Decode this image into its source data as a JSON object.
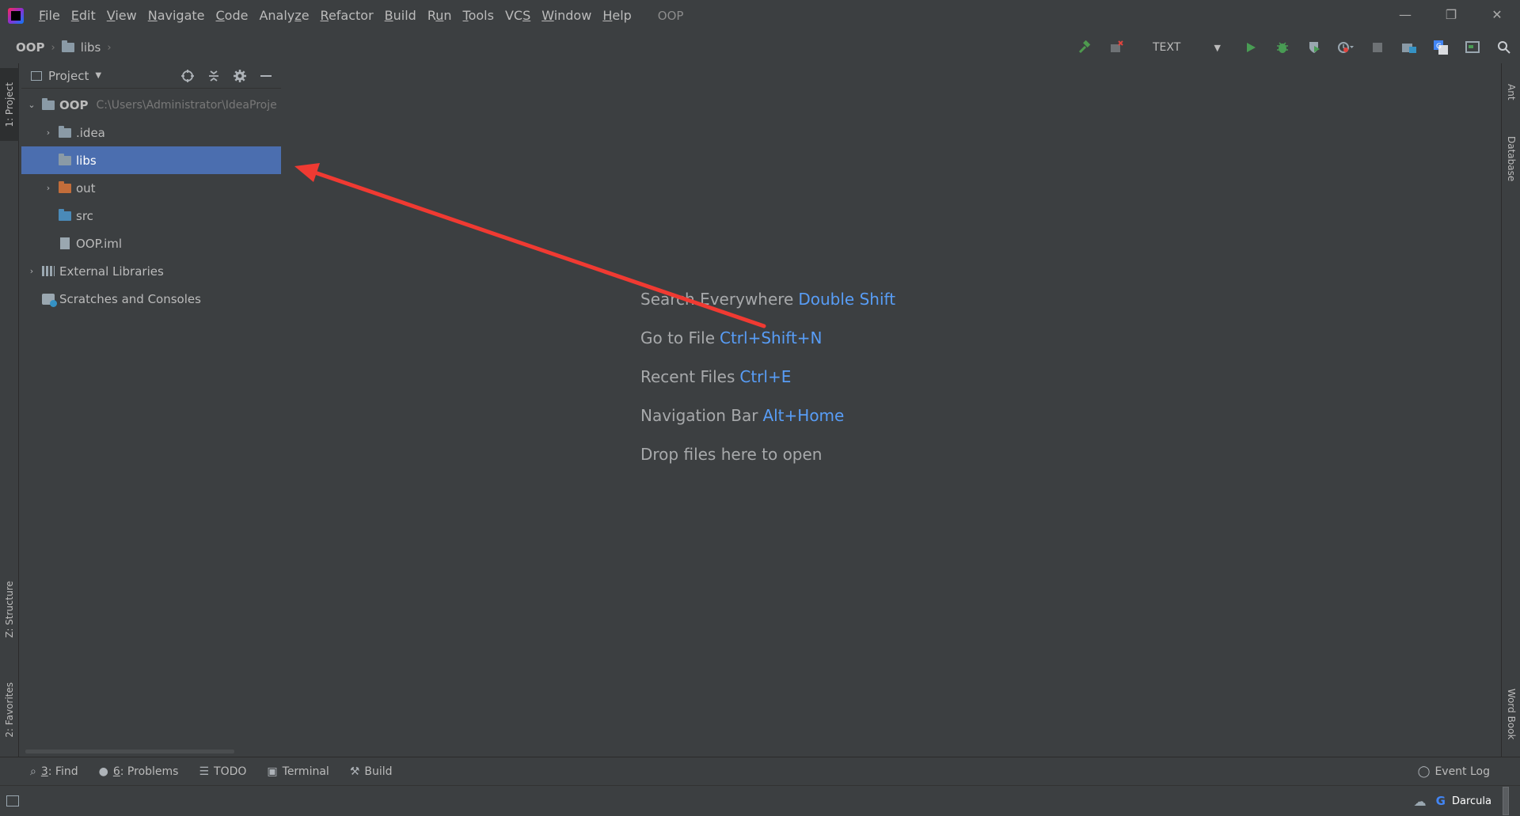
{
  "menubar": {
    "items": [
      {
        "pre": "",
        "ul": "F",
        "post": "ile"
      },
      {
        "pre": "",
        "ul": "E",
        "post": "dit"
      },
      {
        "pre": "",
        "ul": "V",
        "post": "iew"
      },
      {
        "pre": "",
        "ul": "N",
        "post": "avigate"
      },
      {
        "pre": "",
        "ul": "C",
        "post": "ode"
      },
      {
        "pre": "Analy",
        "ul": "z",
        "post": "e"
      },
      {
        "pre": "",
        "ul": "R",
        "post": "efactor"
      },
      {
        "pre": "",
        "ul": "B",
        "post": "uild"
      },
      {
        "pre": "R",
        "ul": "u",
        "post": "n"
      },
      {
        "pre": "",
        "ul": "T",
        "post": "ools"
      },
      {
        "pre": "VC",
        "ul": "S",
        "post": ""
      },
      {
        "pre": "",
        "ul": "W",
        "post": "indow"
      },
      {
        "pre": "",
        "ul": "H",
        "post": "elp"
      }
    ],
    "project_title": "OOP"
  },
  "window_controls": {
    "minimize": "—",
    "restore": "❐",
    "close": "✕"
  },
  "breadcrumb": {
    "root": "OOP",
    "child": "libs"
  },
  "toolbar": {
    "run_config": "TEXT"
  },
  "left_stripe": {
    "project": "1: Project",
    "structure": "Z: Structure",
    "favorites": "2: Favorites"
  },
  "right_stripe": {
    "ant": "Ant",
    "database": "Database",
    "word_book": "Word Book"
  },
  "project_panel": {
    "title": "Project",
    "tree": {
      "root_name": "OOP",
      "root_path": "C:\\Users\\Administrator\\IdeaProje",
      "idea": ".idea",
      "libs": "libs",
      "out": "out",
      "src": "src",
      "iml": "OOP.iml",
      "external": "External Libraries",
      "scratches": "Scratches and Consoles"
    }
  },
  "editor_hints": [
    {
      "label": "Search Everywhere",
      "key": "Double Shift"
    },
    {
      "label": "Go to File",
      "key": "Ctrl+Shift+N"
    },
    {
      "label": "Recent Files",
      "key": "Ctrl+E"
    },
    {
      "label": "Navigation Bar",
      "key": "Alt+Home"
    },
    {
      "label": "Drop files here to open",
      "key": ""
    }
  ],
  "bottom_bar": {
    "find_num": "3",
    "find_label": ": Find",
    "problems_num": "6",
    "problems_label": ": Problems",
    "todo": "TODO",
    "terminal": "Terminal",
    "build": "Build",
    "event_log": "Event Log"
  },
  "status_bar": {
    "theme": "Darcula",
    "google": "G"
  },
  "colors": {
    "selection": "#4b6eaf",
    "hint_key": "#589df6",
    "annotation_arrow": "#f03a32"
  }
}
